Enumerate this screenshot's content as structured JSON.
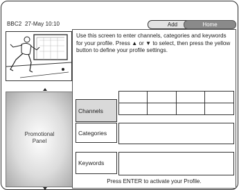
{
  "status": {
    "channel": "BBC2",
    "date": "27-May",
    "time": "10:10"
  },
  "tabs": {
    "add": "Add",
    "home": "Home"
  },
  "thumbnail": {
    "icon": "football-player-icon"
  },
  "promo": {
    "line1": "Promotional",
    "line2": "Panel"
  },
  "info_text": "Use this screen to enter channels, categories and keywords for your profile. Press ▲ or ▼ to select, then press the yellow button to define your profile settings.",
  "rows": {
    "channels": "Channels",
    "categories": "Categories",
    "keywords": "Keywords"
  },
  "footer": "Press ENTER to activate your Profile."
}
